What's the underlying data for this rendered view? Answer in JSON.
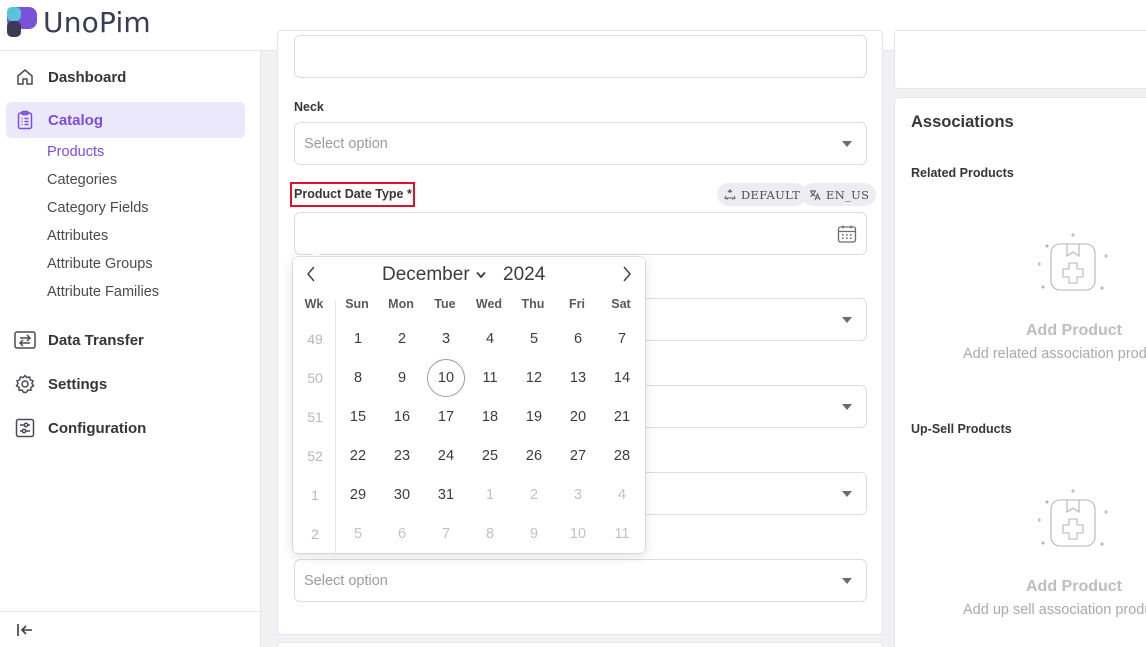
{
  "app": {
    "name": "UnoPim"
  },
  "sidebar": {
    "dashboard": "Dashboard",
    "catalog": "Catalog",
    "catalog_items": [
      "Products",
      "Categories",
      "Category Fields",
      "Attributes",
      "Attribute Groups",
      "Attribute Families"
    ],
    "data_transfer": "Data Transfer",
    "settings": "Settings",
    "configuration": "Configuration"
  },
  "form": {
    "neck_label": "Neck",
    "select_placeholder": "Select option",
    "date_label": "Product Date Type *",
    "chip_channel": "DEFAULT",
    "chip_locale": "EN_US"
  },
  "calendar": {
    "month": "December",
    "year": "2024",
    "headers": [
      "Wk",
      "Sun",
      "Mon",
      "Tue",
      "Wed",
      "Thu",
      "Fri",
      "Sat"
    ],
    "weeks": [
      {
        "wk": "49",
        "days": [
          "1",
          "2",
          "3",
          "4",
          "5",
          "6",
          "7"
        ]
      },
      {
        "wk": "50",
        "days": [
          "8",
          "9",
          "10",
          "11",
          "12",
          "13",
          "14"
        ]
      },
      {
        "wk": "51",
        "days": [
          "15",
          "16",
          "17",
          "18",
          "19",
          "20",
          "21"
        ]
      },
      {
        "wk": "52",
        "days": [
          "22",
          "23",
          "24",
          "25",
          "26",
          "27",
          "28"
        ]
      },
      {
        "wk": "1",
        "days": [
          "29",
          "30",
          "31",
          "1",
          "2",
          "3",
          "4"
        ]
      },
      {
        "wk": "2",
        "days": [
          "5",
          "6",
          "7",
          "8",
          "9",
          "10",
          "11"
        ]
      }
    ],
    "today": "10"
  },
  "associations": {
    "title": "Associations",
    "related_label": "Related Products",
    "related_empty_title": "Add Product",
    "related_empty_desc": "Add related association products",
    "upsell_label": "Up-Sell Products",
    "upsell_empty_title": "Add Product",
    "upsell_empty_desc": "Add up sell association products"
  },
  "colors": {
    "accent": "#7c4ddc",
    "highlight": "#e0102a"
  }
}
